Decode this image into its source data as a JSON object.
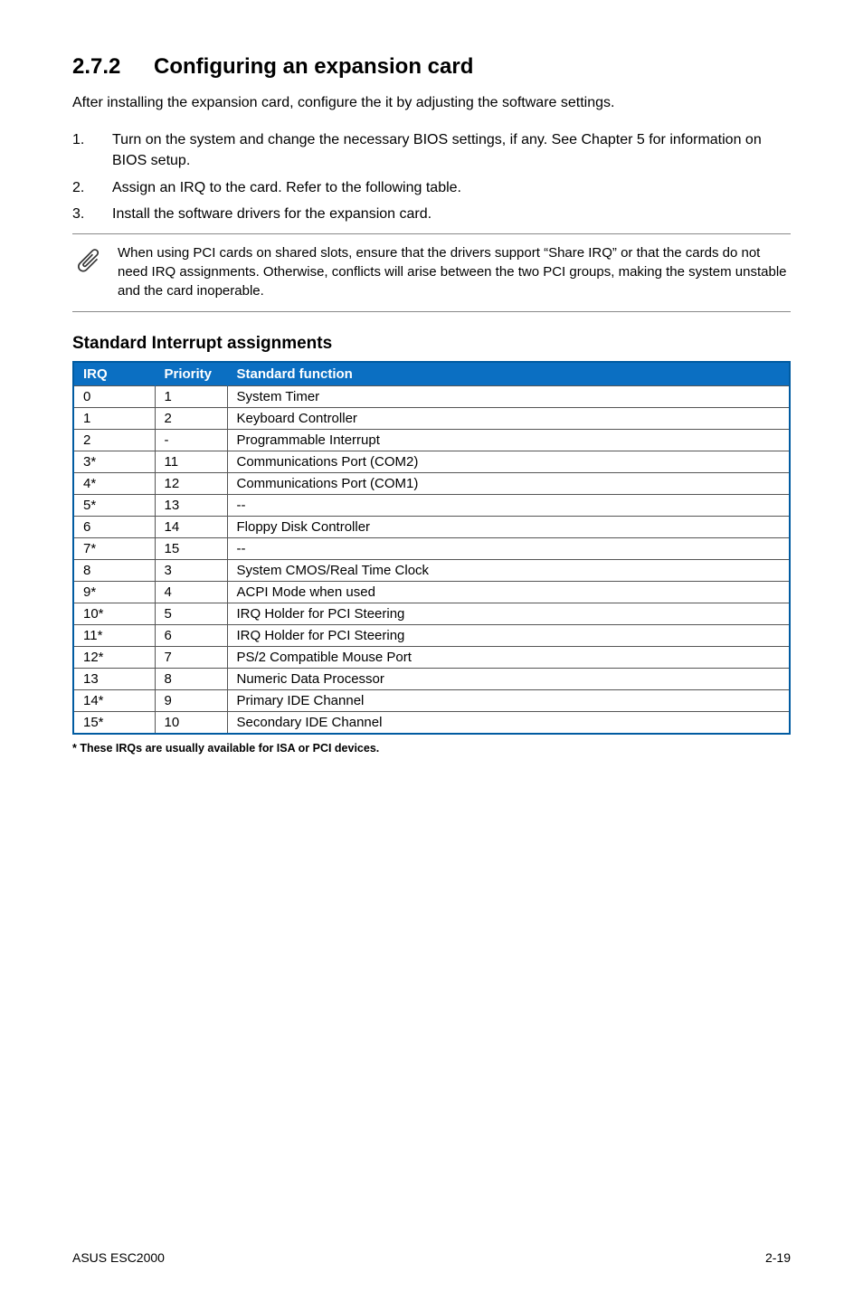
{
  "section": {
    "number": "2.7.2",
    "title": "Configuring an expansion card"
  },
  "intro": "After installing the expansion card, configure the it by adjusting the software settings.",
  "steps": [
    {
      "n": "1.",
      "t": "Turn on the system and change the necessary BIOS settings, if any. See Chapter 5 for information on BIOS setup."
    },
    {
      "n": "2.",
      "t": "Assign an IRQ to the card. Refer to the following table."
    },
    {
      "n": "3.",
      "t": "Install the software drivers for the expansion card."
    }
  ],
  "note": "When using PCI cards on shared slots, ensure that the drivers support “Share IRQ” or that the cards do not need IRQ assignments. Otherwise, conflicts will arise between the two PCI groups, making the system unstable and the card inoperable.",
  "table_title": "Standard Interrupt assignments",
  "headers": {
    "irq": "IRQ",
    "priority": "Priority",
    "func": "Standard function"
  },
  "rows": [
    {
      "irq": "0",
      "pri": "1",
      "func": "System Timer"
    },
    {
      "irq": "1",
      "pri": "2",
      "func": "Keyboard Controller"
    },
    {
      "irq": "2",
      "pri": "-",
      "func": "Programmable Interrupt"
    },
    {
      "irq": "3*",
      "pri": "11",
      "func": "Communications Port (COM2)"
    },
    {
      "irq": "4*",
      "pri": "12",
      "func": "Communications Port (COM1)"
    },
    {
      "irq": "5*",
      "pri": "13",
      "func": "--"
    },
    {
      "irq": "6",
      "pri": "14",
      "func": "Floppy Disk Controller"
    },
    {
      "irq": "7*",
      "pri": "15",
      "func": "--"
    },
    {
      "irq": "8",
      "pri": "3",
      "func": "System CMOS/Real Time Clock"
    },
    {
      "irq": "9*",
      "pri": "4",
      "func": "ACPI Mode when used"
    },
    {
      "irq": "10*",
      "pri": "5",
      "func": "IRQ Holder for PCI Steering"
    },
    {
      "irq": "11*",
      "pri": "6",
      "func": "IRQ Holder for PCI Steering"
    },
    {
      "irq": "12*",
      "pri": "7",
      "func": "PS/2 Compatible Mouse Port"
    },
    {
      "irq": "13",
      "pri": "8",
      "func": "Numeric Data Processor"
    },
    {
      "irq": "14*",
      "pri": "9",
      "func": "Primary IDE Channel"
    },
    {
      "irq": "15*",
      "pri": "10",
      "func": "Secondary IDE Channel"
    }
  ],
  "footnote": "* These IRQs are usually available for ISA or PCI devices.",
  "footer": {
    "left": "ASUS ESC2000",
    "right": "2-19"
  }
}
